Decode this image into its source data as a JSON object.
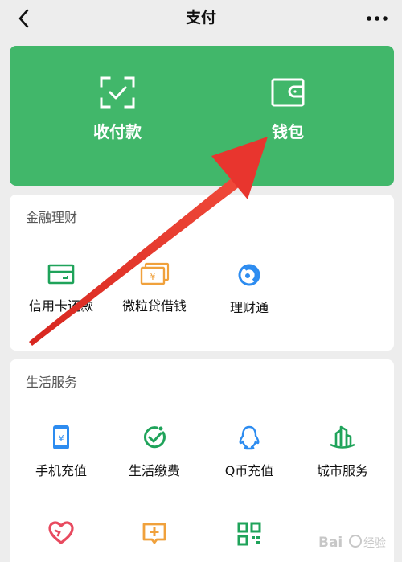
{
  "nav": {
    "title": "支付"
  },
  "pay_panel": {
    "receive_label": "收付款",
    "wallet_label": "钱包"
  },
  "finance": {
    "header": "金融理财",
    "items": [
      {
        "label": "信用卡还款",
        "icon": "credit-card-icon"
      },
      {
        "label": "微粒贷借钱",
        "icon": "cash-icon"
      },
      {
        "label": "理财通",
        "icon": "wealth-icon"
      }
    ]
  },
  "life": {
    "header": "生活服务",
    "items": [
      {
        "label": "手机充值",
        "icon": "phone-recharge-icon"
      },
      {
        "label": "生活缴费",
        "icon": "utility-bill-icon"
      },
      {
        "label": "Q币充值",
        "icon": "qq-coin-icon"
      },
      {
        "label": "城市服务",
        "icon": "city-service-icon"
      }
    ]
  },
  "colors": {
    "brand_green": "#41b76a",
    "icon_green": "#1fa35a",
    "icon_orange": "#f0a13c",
    "icon_blue": "#2d8cf0",
    "icon_red": "#e84a5f",
    "annotation_red": "#e8352e"
  },
  "watermark": "Bai 经验"
}
